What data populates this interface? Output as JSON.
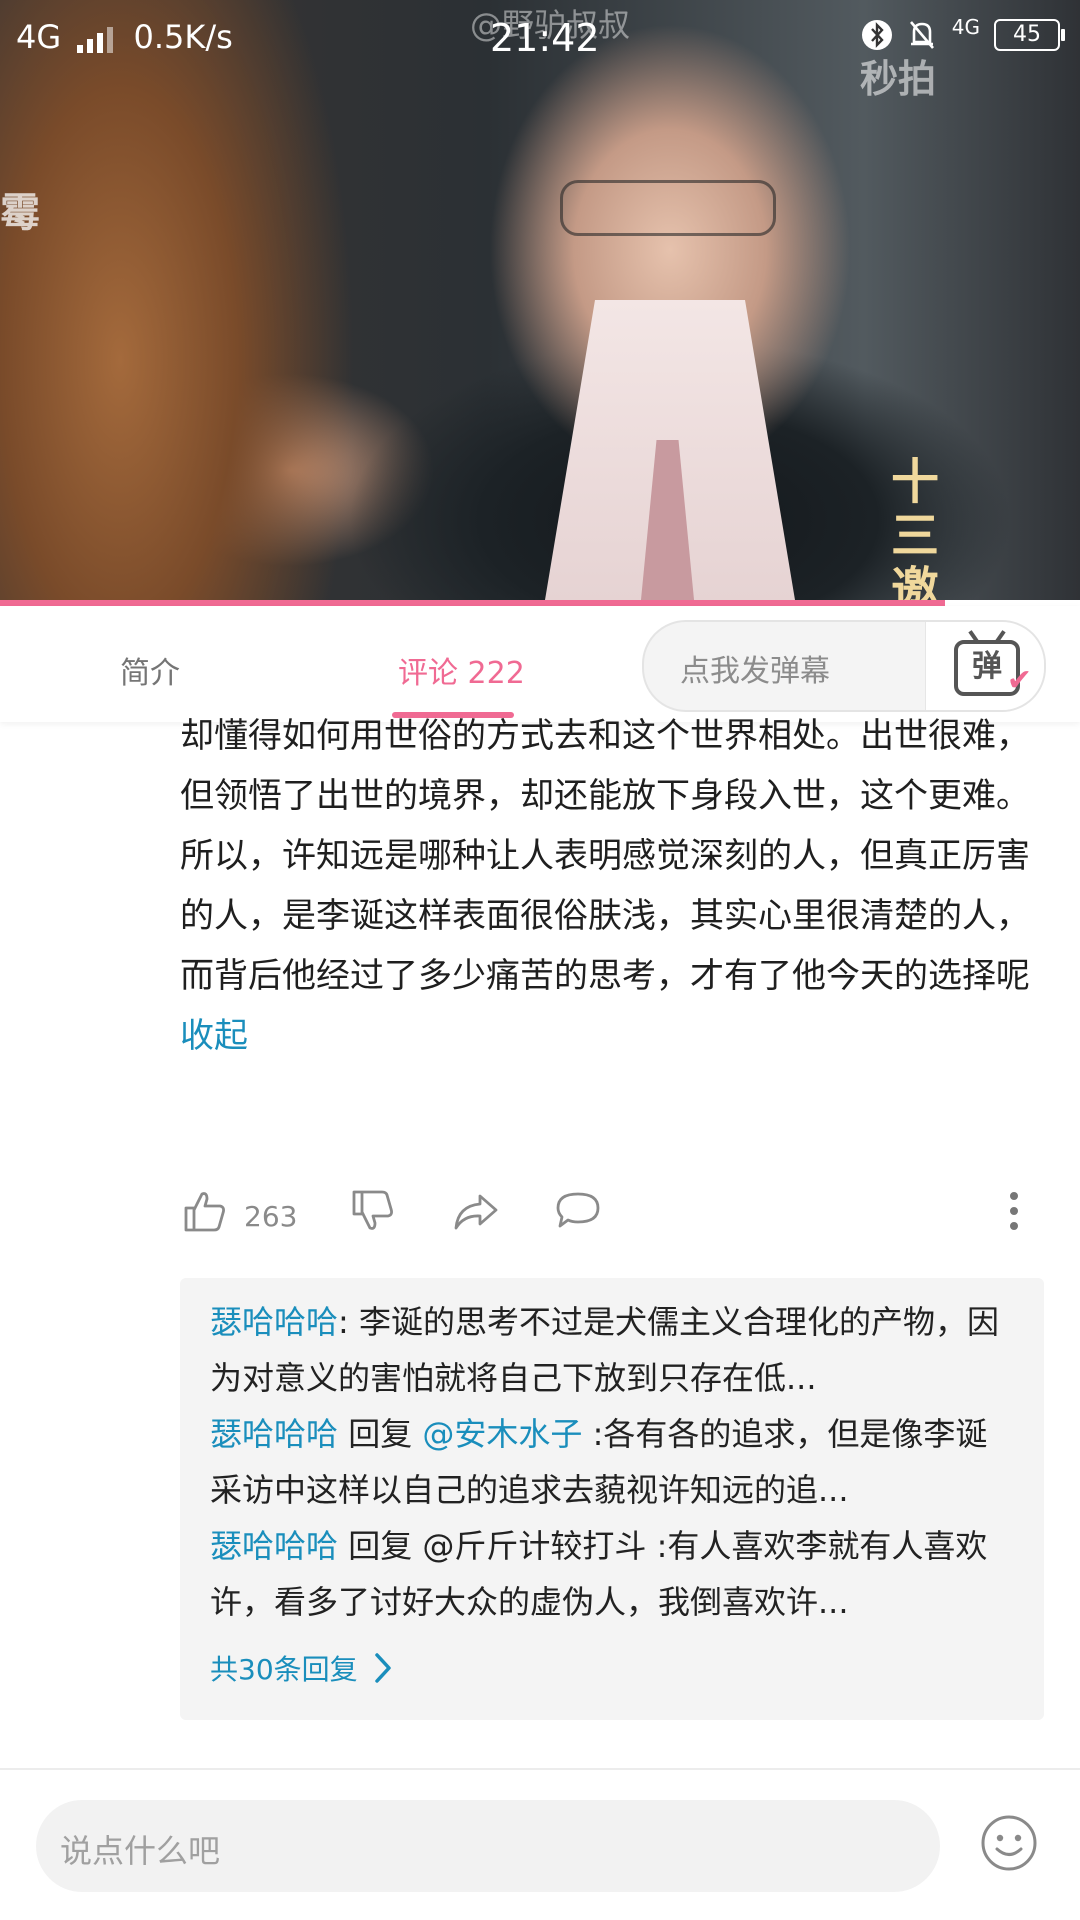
{
  "status_bar": {
    "network": "4G",
    "speed": "0.5K/s",
    "time": "21:42",
    "network_right": "4G",
    "battery": "45"
  },
  "video": {
    "watermark": "@野驴叔叔",
    "logo": "秒拍",
    "side_text": "霉",
    "show_logo": "十三邀",
    "progress": 0.875
  },
  "tabs": {
    "intro": "简介",
    "comments": "评论 222",
    "danmaku_placeholder": "点我发弹幕",
    "danmaku_icon_char": "弹"
  },
  "comment": {
    "text": "却懂得如何用世俗的方式去和这个世界相处。出世很难，但领悟了出世的境界，却还能放下身段入世，这个更难。所以，许知远是哪种让人表明感觉深刻的人，但真正厉害的人，是李诞这样表面很俗肤浅，其实心里很清楚的人，而背后他经过了多少痛苦的思考，才有了他今天的选择呢",
    "collapse": "收起",
    "likes": "263"
  },
  "replies": [
    {
      "user": "瑟哈哈哈",
      "reply_word": "",
      "reply_to": "",
      "text": ": 李诞的思考不过是犬儒主义合理化的产物，因为对意义的害怕就将自己下放到只存在低..."
    },
    {
      "user": "瑟哈哈哈",
      "reply_word": " 回复 ",
      "reply_to": "@安木水子",
      "text": " :各有各的追求，但是像李诞采访中这样以自己的追求去藐视许知远的追..."
    },
    {
      "user": "瑟哈哈哈",
      "reply_word": " 回复 ",
      "reply_to": "@斤斤计较打斗",
      "text": " :有人喜欢李就有人喜欢许，看多了讨好大众的虚伪人，我倒喜欢许..."
    }
  ],
  "more_replies": "共30条回复",
  "input": {
    "placeholder": "说点什么吧"
  },
  "colors": {
    "accent": "#f06a93",
    "link": "#1a8ebc"
  }
}
